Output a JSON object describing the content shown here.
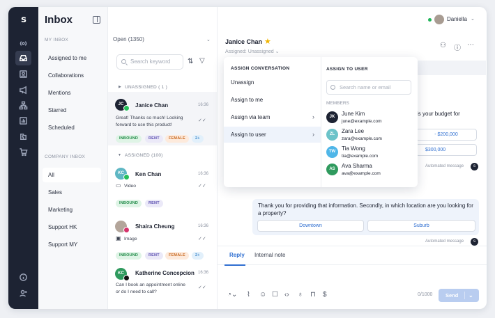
{
  "rail": {
    "logo": "s"
  },
  "left_sidebar": {
    "title": "Inbox",
    "my_inbox_header": "MY INBOX",
    "my_inbox_items": [
      "Assigned to me",
      "Collaborations",
      "Mentions",
      "Starred",
      "Scheduled"
    ],
    "company_inbox_header": "COMPANY INBOX",
    "company_inbox_items": [
      "All",
      "Sales",
      "Marketing",
      "Support HK",
      "Support MY"
    ]
  },
  "conversation_list": {
    "filter_label": "Open (1350)",
    "search_placeholder": "Search keyword",
    "unassigned_header": "UNASSIGNED ( 1 )",
    "assigned_header": "ASSIGNED (100)",
    "conversations": [
      {
        "initials": "JC",
        "name": "Janice Chan",
        "time": "16:36",
        "preview_1": "Great! Thanks so much! Looking",
        "preview_2": "forward to use this product!",
        "tags": [
          "INBOUND",
          "RENT",
          "FEMALE",
          "2+"
        ]
      },
      {
        "initials": "KC",
        "name": "Ken Chan",
        "time": "16:36",
        "preview_1": "Video",
        "tags": [
          "INBOUND",
          "RENT"
        ]
      },
      {
        "initials": "",
        "name": "Shaira Cheung",
        "time": "16:36",
        "preview_1": "Image",
        "tags": [
          "INBOUND",
          "RENT",
          "FEMALE",
          "2+"
        ]
      },
      {
        "initials": "KC",
        "name": "Katherine Concepcion",
        "time": "16:36",
        "preview_1": "Can I book an appointment online",
        "preview_2": "or do I need to call?"
      }
    ]
  },
  "header": {
    "user_name": "Daniella",
    "contact_name": "Janice Chan",
    "assigned_label": "Assigned:",
    "assigned_value": "Unassigned"
  },
  "chat": {
    "partial_question": "is your budget for",
    "partial_option_1": "- $200,000",
    "partial_option_2": "$300,000",
    "automated_label": "Automated message",
    "message_1": "Thank you for providing that information. Secondly, in which location are you looking for a property?",
    "option_1": "Downtown",
    "option_2": "Suburb"
  },
  "composer": {
    "tab_reply": "Reply",
    "tab_internal_note": "Internal note",
    "char_count": "0/1000",
    "send_label": "Send"
  },
  "assign_dropdown": {
    "header": "ASSIGN CONVERSATION",
    "options": [
      "Unassign",
      "Assign to me",
      "Assign via team",
      "Assign to user"
    ],
    "user_header": "ASSIGN TO USER",
    "user_search_placeholder": "Search name or email",
    "members_label": "MEMBERS",
    "members": [
      {
        "initials": "JK",
        "name": "June Kim",
        "email": "june@example.com",
        "color": "#1d2333"
      },
      {
        "initials": "ZL",
        "name": "Zara Lee",
        "email": "zara@example.com",
        "color": "#6cc3c9"
      },
      {
        "initials": "TW",
        "name": "Tia Wong",
        "email": "tia@example.com",
        "color": "#4fb6e8"
      },
      {
        "initials": "AS",
        "name": "Ava Sharma",
        "email": "ava@example.com",
        "color": "#2f9a5e"
      }
    ]
  }
}
